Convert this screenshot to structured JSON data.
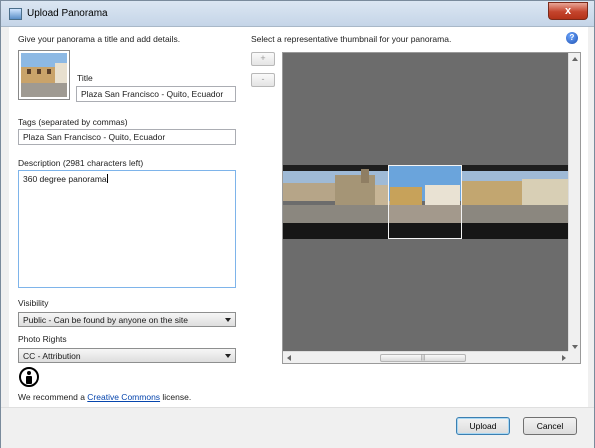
{
  "window": {
    "title": "Upload Panorama",
    "close_label": "x"
  },
  "form": {
    "intro": "Give your panorama a title and add details.",
    "title_label": "Title",
    "title_value": "Plaza San Francisco - Quito, Ecuador",
    "tags_label": "Tags (separated by commas)",
    "tags_value": "Plaza San Francisco - Quito, Ecuador",
    "description_label": "Description (2981 characters left)",
    "description_value": "360 degree panorama",
    "visibility_label": "Visibility",
    "visibility_value": "Public - Can be found by anyone on the site",
    "rights_label": "Photo Rights",
    "rights_value": "CC - Attribution",
    "license_prefix": "We recommend a ",
    "license_link": "Creative Commons",
    "license_suffix": " license."
  },
  "thumbnail": {
    "instruction": "Select a representative thumbnail for your panorama.",
    "zoom_in": "+",
    "zoom_out": "-",
    "help": "?",
    "scroll_grip": "|||"
  },
  "footer": {
    "upload_label": "Upload",
    "cancel_label": "Cancel"
  },
  "colors": {
    "accent": "#3c7fb1",
    "link": "#0645ad",
    "viewer_bg": "#6c6c6c"
  }
}
